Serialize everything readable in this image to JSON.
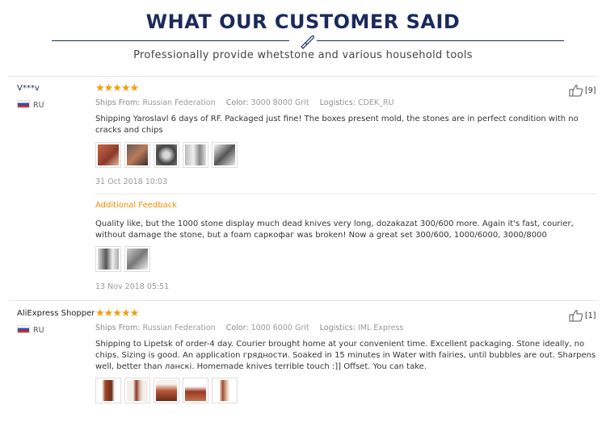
{
  "header": {
    "title": "WHAT OUR CUSTOMER SAID",
    "subtitle": "Professionally provide whetstone and various household tools",
    "icon": "knife-icon"
  },
  "reviews": [
    {
      "user": "V***v",
      "country": "RU",
      "rating": "★★★★★",
      "helpful": "[9]",
      "ships_from_label": "Ships From:",
      "ships_from": "Russian Federation",
      "color_label": "Color:",
      "color": "3000 8000 Grit",
      "logistics_label": "Logistics:",
      "logistics": "CDEK_RU",
      "text": "Shipping Yaroslavl 6 days of RF. Packaged just fine! The boxes present mold, the stones are in perfect condition with no cracks and chips",
      "date": "31 Oct 2018 10:03",
      "additional": {
        "label": "Additional Feedback",
        "text": "Quality like, but the 1000 stone display much dead knives very long, dozakazat 300/600 more. Again it's fast, courier, without damage the stone, but a foam саркофаг was broken! Now a great set 300/600, 1000/6000, 3000/8000",
        "date": "13 Nov 2018 05:51"
      }
    },
    {
      "user": "AliExpress Shopper",
      "country": "RU",
      "rating": "★★★★★",
      "helpful": "[1]",
      "ships_from_label": "Ships From:",
      "ships_from": "Russian Federation",
      "color_label": "Color:",
      "color": "1000 6000 Grit",
      "logistics_label": "Logistics:",
      "logistics": "IML Express",
      "text": "Shipping to Lipetsk of order-4 day. Courier brought home at your convenient time. Excellent packaging. Stone ideally, no chips. Sizing is good. An application грядности. Soaked in 15 minutes in Water with fairies, until bubbles are out. Sharpens well, better than ланскі. Homemade knives terrible touch :]] Offset. You can take."
    }
  ],
  "colors": {
    "title": "#1b2a5c",
    "star": "#f39c12",
    "additional_feedback": "#f08c00"
  }
}
